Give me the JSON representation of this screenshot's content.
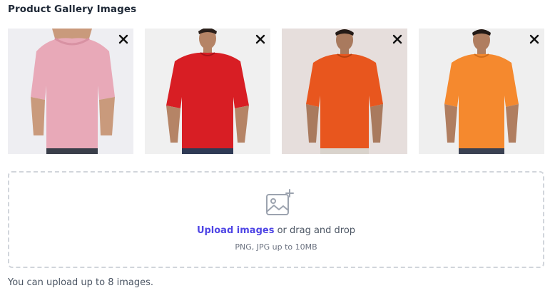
{
  "section": {
    "title": "Product Gallery Images"
  },
  "gallery": {
    "images": [
      {
        "alt": "pink t-shirt",
        "remove_icon": "close-icon",
        "shirt_color": "#e8a9b8",
        "bg_color": "#eeeef2"
      },
      {
        "alt": "red t-shirt",
        "remove_icon": "close-icon",
        "shirt_color": "#d81e24",
        "bg_color": "#f0f0f0"
      },
      {
        "alt": "orange-red t-shirt",
        "remove_icon": "close-icon",
        "shirt_color": "#e8561e",
        "bg_color": "#e6dedc"
      },
      {
        "alt": "orange t-shirt",
        "remove_icon": "close-icon",
        "shirt_color": "#f5892e",
        "bg_color": "#efefef"
      }
    ]
  },
  "dropzone": {
    "icon": "image-add-icon",
    "link_label": "Upload images",
    "rest_label": " or drag and drop",
    "hint": "PNG, JPG up to 10MB"
  },
  "helper": {
    "text": "You can upload up to 8 images."
  },
  "colors": {
    "accent": "#4f46e5",
    "border": "#d1d5db",
    "heading": "#1f2937"
  }
}
